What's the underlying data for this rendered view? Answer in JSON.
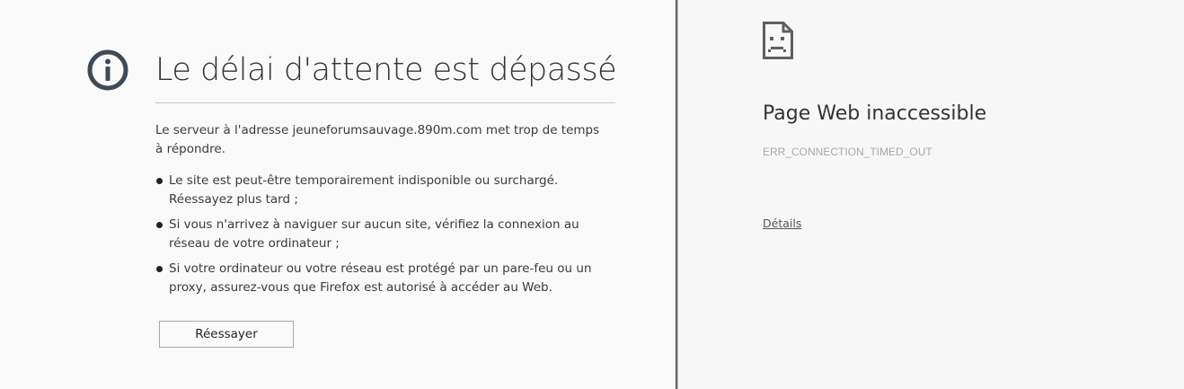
{
  "firefox": {
    "icon": "info-circle-icon",
    "title": "Le délai d'attente est dépassé",
    "intro": "Le serveur à l'adresse jeuneforumsauvage.890m.com met trop de temps à répondre.",
    "bullets": [
      "Le site est peut-être temporairement indisponible ou surchargé. Réessayez plus tard ;",
      "Si vous n'arrivez à naviguer sur aucun site, vérifiez la connexion au réseau de votre ordinateur ;",
      "Si votre ordinateur ou votre réseau est protégé par un pare-feu ou un proxy, assurez-vous que Firefox est autorisé à accéder au Web."
    ],
    "retry_label": "Réessayer",
    "colors": {
      "icon": "#3f4a55",
      "text": "#333333"
    }
  },
  "chrome": {
    "icon": "sad-page-icon",
    "title": "Page Web inaccessible",
    "error_code": "ERR_CONNECTION_TIMED_OUT",
    "details_label": "Détails",
    "colors": {
      "text": "#333333",
      "code": "#a8a8a8"
    }
  }
}
